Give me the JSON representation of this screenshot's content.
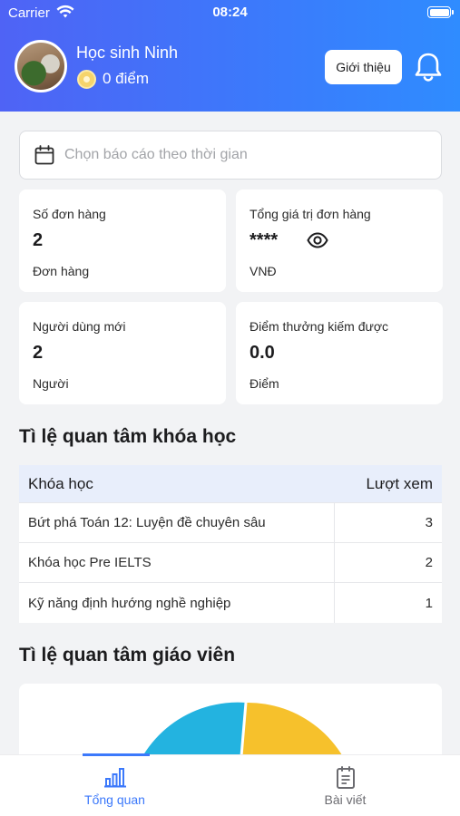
{
  "status_bar": {
    "carrier": "Carrier",
    "time": "08:24"
  },
  "header": {
    "username": "Học sinh Ninh",
    "points": "0 điểm",
    "intro_button": "Giới thiệu",
    "gradient_start": "#4f63f5",
    "gradient_end": "#2f8cff"
  },
  "date_filter": {
    "placeholder": "Chọn báo cáo theo thời gian"
  },
  "stats": [
    {
      "label": "Số đơn hàng",
      "value": "2",
      "unit": "Đơn hàng"
    },
    {
      "label": "Tổng giá trị đơn hàng",
      "value": "****",
      "unit": "VNĐ",
      "icon": "eye-icon"
    },
    {
      "label": "Người dùng mới",
      "value": "2",
      "unit": "Người"
    },
    {
      "label": "Điểm thưởng kiếm được",
      "value": "0.0",
      "unit": "Điểm"
    }
  ],
  "course_section": {
    "title": "Tì lệ quan tâm khóa học",
    "headers": {
      "course": "Khóa học",
      "views": "Lượt xem"
    },
    "rows": [
      {
        "course": "Bứt phá Toán 12: Luyện đề chuyên sâu",
        "views": "3"
      },
      {
        "course": "Khóa học Pre IELTS",
        "views": "2"
      },
      {
        "course": "Kỹ năng định hướng nghề nghiệp",
        "views": "1"
      }
    ]
  },
  "teacher_section": {
    "title": "Tì lệ quan tâm giáo viên",
    "colors": {
      "slice_a": "#23b3e0",
      "slice_b": "#f6c12c"
    }
  },
  "tabs": [
    {
      "label": "Tổng quan",
      "icon": "bar-chart-icon",
      "active": true
    },
    {
      "label": "Bài viết",
      "icon": "document-icon",
      "active": false
    }
  ],
  "accent_color": "#3c79fb"
}
